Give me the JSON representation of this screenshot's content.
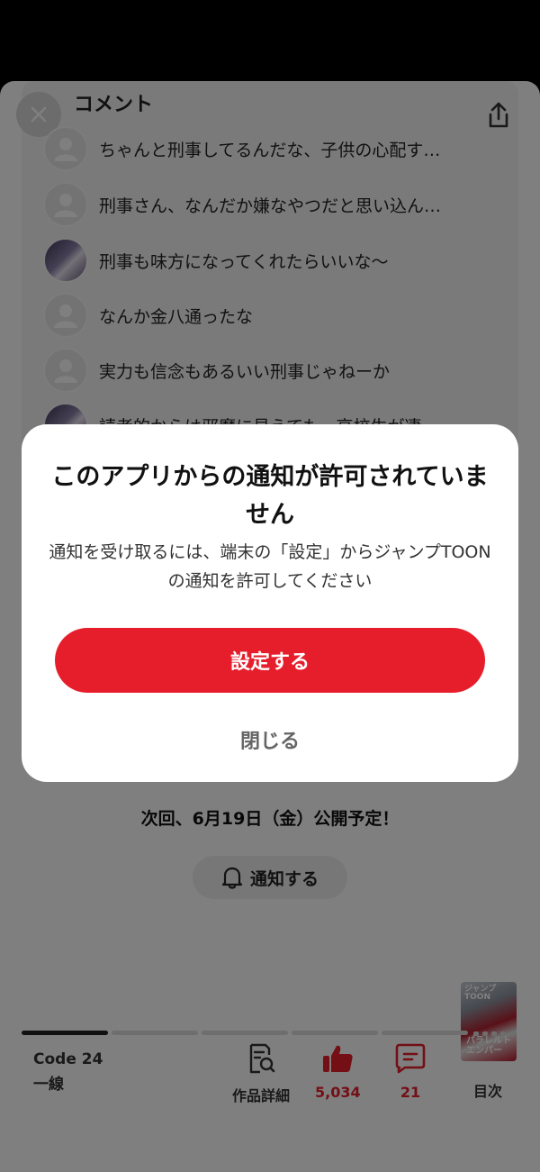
{
  "comments": {
    "title": "コメント",
    "items": [
      {
        "text": "ちゃんと刑事してるんだな、子供の心配す…",
        "avatar": "default"
      },
      {
        "text": "刑事さん、なんだか嫌なやつだと思い込ん…",
        "avatar": "default"
      },
      {
        "text": "刑事も味方になってくれたらいいな〜",
        "avatar": "custom"
      },
      {
        "text": "なんか金八通ったな",
        "avatar": "default"
      },
      {
        "text": "実力も信念もあるいい刑事じゃねーか",
        "avatar": "default"
      },
      {
        "text": "読者的からは邪魔に見えても、高校生が凄",
        "avatar": "custom"
      }
    ]
  },
  "schedule_text": "次回、6月19日（金）公開予定！",
  "notify_button_label": "通知する",
  "series": {
    "title_line1": "Code 24",
    "title_line2": "一線"
  },
  "toolbar": {
    "details_label": "作品詳細",
    "likes": "5,034",
    "comments_count": "21",
    "toc_label": "目次",
    "thumb_logo": "ジャンプ\nTOON",
    "thumb_title": "パラレルト\nエンパー"
  },
  "dialog": {
    "title": "このアプリからの通知が許可されていません",
    "body": "通知を受け取るには、端末の「設定」からジャンプTOONの通知を許可してください",
    "primary_label": "設定する",
    "close_label": "閉じる"
  },
  "colors": {
    "accent": "#e61e2b",
    "overlay": "rgba(0,0,0,0.5)"
  }
}
